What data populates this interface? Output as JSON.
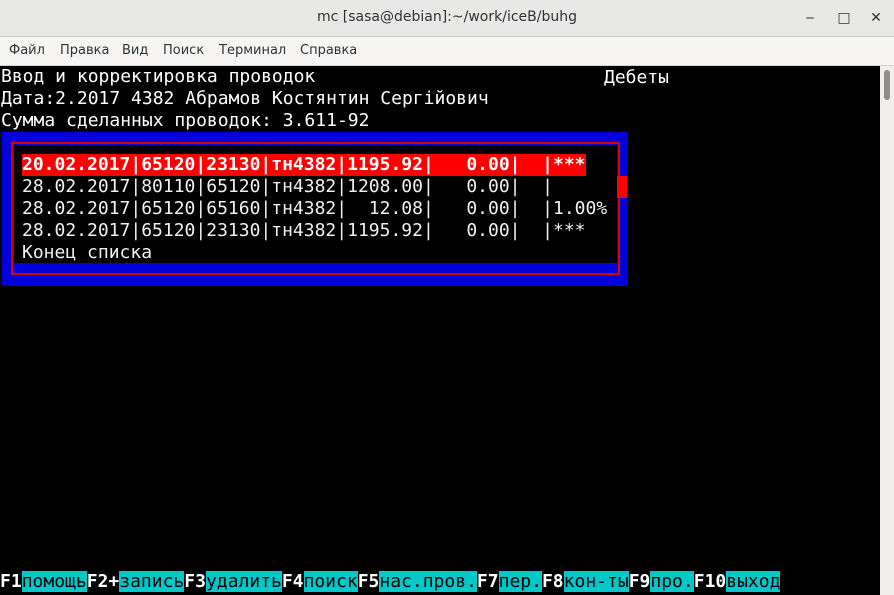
{
  "window": {
    "title": "mc [sasa@debian]:~/work/iceB/buhg",
    "minimize_glyph": "‒",
    "maximize_glyph": "□",
    "close_glyph": "✕"
  },
  "menu": [
    "Файл",
    "Правка",
    "Вид",
    "Поиск",
    "Терминал",
    "Справка"
  ],
  "header": {
    "line1": "Ввод и корректировка проводок",
    "line1_right": "Дебеты",
    "line2": "Дата:2.2017 4382 Абрамов Костянтин Сергійович",
    "line3": "Сумма сделанных проводок: 3.611-92"
  },
  "list": {
    "rows": [
      "20.02.2017|65120|23130|тн4382|1195.92|   0.00|  |***",
      "28.02.2017|80110|65120|тн4382|1208.00|   0.00|  |",
      "28.02.2017|65120|65160|тн4382|  12.08|   0.00|  |1.00%",
      "28.02.2017|65120|23130|тн4382|1195.92|   0.00|  |***"
    ],
    "end": "Конец списка",
    "selected_index": 0
  },
  "fkeys": [
    {
      "key": "F1",
      "label": "помощь"
    },
    {
      "key": "F2+",
      "label": "запись"
    },
    {
      "key": "F3",
      "label": "удалить"
    },
    {
      "key": "F4",
      "label": "поиск"
    },
    {
      "key": "F5",
      "label": "нас.пров."
    },
    {
      "key": "F7",
      "label": "пер."
    },
    {
      "key": "F8",
      "label": "кон-ты"
    },
    {
      "key": "F9",
      "label": "про."
    },
    {
      "key": "F10",
      "label": "выход"
    }
  ],
  "colors": {
    "selection": "#ff0000",
    "box_blue": "#0000d8",
    "fkey_label_bg": "#00c8c8"
  }
}
